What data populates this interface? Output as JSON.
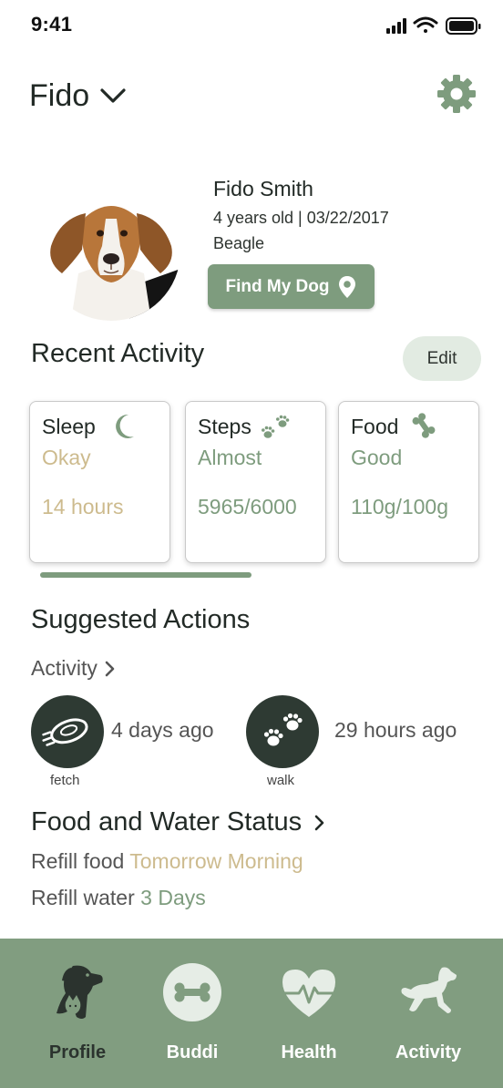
{
  "status_bar": {
    "time": "9:41"
  },
  "header": {
    "dog_name": "Fido"
  },
  "profile": {
    "full_name": "Fido Smith",
    "age_birthdate": "4 years old | 03/22/2017",
    "breed": "Beagle",
    "find_button_label": "Find My Dog"
  },
  "recent_activity": {
    "title": "Recent Activity",
    "edit_label": "Edit",
    "cards": [
      {
        "title": "Sleep",
        "status": "Okay",
        "value": "14 hours",
        "icon": "moon-icon"
      },
      {
        "title": "Steps",
        "status": "Almost",
        "value": "5965/6000",
        "icon": "paw-prints-icon"
      },
      {
        "title": "Food",
        "status": "Good",
        "value": "110g/100g",
        "icon": "bone-icon"
      }
    ]
  },
  "suggested_actions": {
    "title": "Suggested Actions",
    "activity_link": "Activity",
    "actions": [
      {
        "label": "fetch",
        "time": "4 days ago",
        "icon": "frisbee-icon"
      },
      {
        "label": "walk",
        "time": "29 hours ago",
        "icon": "paw-prints-icon"
      }
    ]
  },
  "food_water": {
    "title": "Food and Water Status",
    "refill_food_label": "Refill food",
    "refill_food_value": "Tomorrow Morning",
    "refill_water_label": "Refill water",
    "refill_water_value": "3 Days"
  },
  "bottom_nav": {
    "items": [
      {
        "label": "Profile",
        "icon": "dog-cat-icon",
        "active": true
      },
      {
        "label": "Buddi",
        "icon": "bone-icon"
      },
      {
        "label": "Health",
        "icon": "heartbeat-icon"
      },
      {
        "label": "Activity",
        "icon": "running-dog-icon"
      }
    ]
  },
  "colors": {
    "accent_sage": "#7e9c7e",
    "accent_tan": "#cdbb8e",
    "nav_background": "#819d80",
    "dark_circle": "#2e3a33"
  }
}
